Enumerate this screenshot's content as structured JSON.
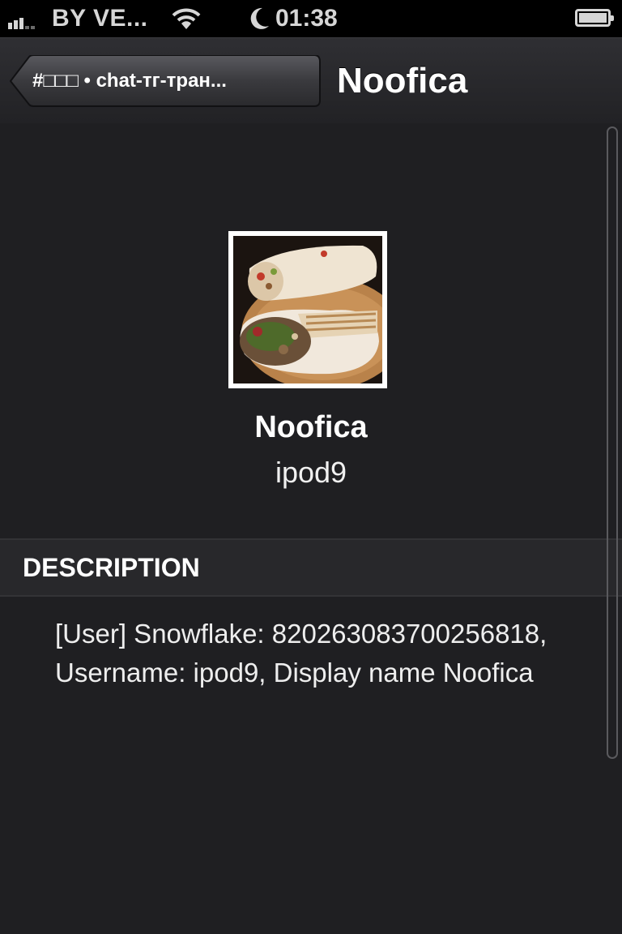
{
  "status_bar": {
    "carrier": "BY VE...",
    "time": "01:38"
  },
  "nav": {
    "back_label": "#□□□ • chat-тг-тран...",
    "title": "Noofica"
  },
  "profile": {
    "display_name": "Noofica",
    "username": "ipod9"
  },
  "description_section": {
    "header": "DESCRIPTION",
    "text": "[User] Snowflake: 820263083700256818, Username: ipod9, Display name Noofica"
  }
}
